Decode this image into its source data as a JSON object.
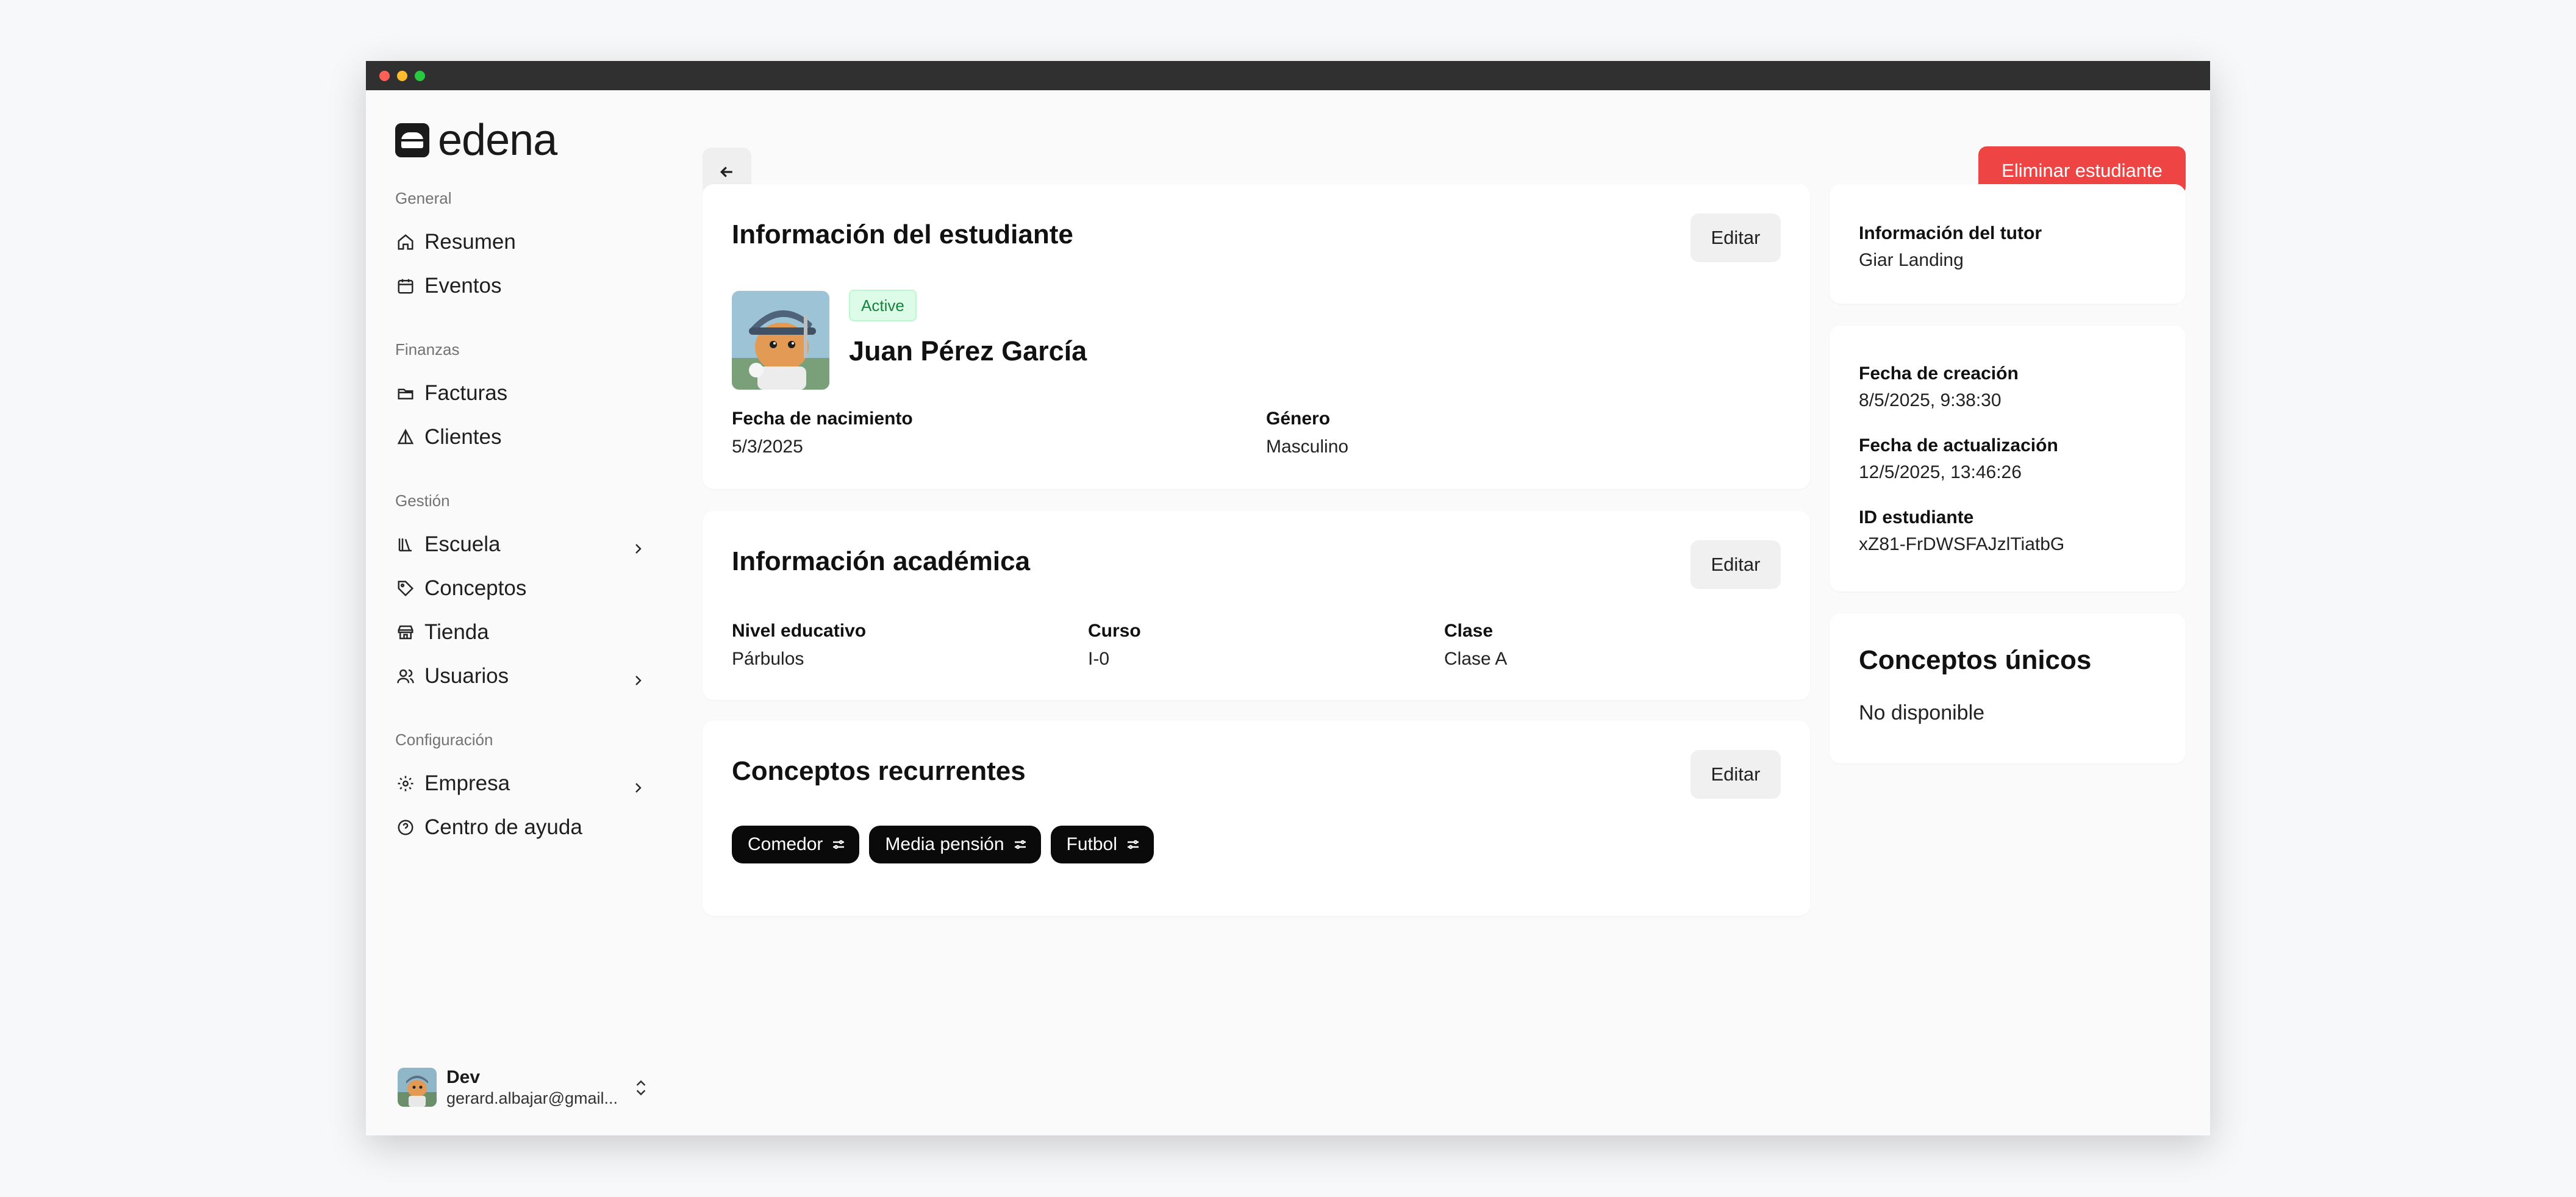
{
  "window": {
    "controls": [
      "#ff5f57",
      "#febc2e",
      "#28c840"
    ]
  },
  "brand": {
    "name": "edena"
  },
  "sidebar": {
    "sections": [
      {
        "heading": "General",
        "items": [
          {
            "label": "Resumen",
            "icon": "home-icon"
          },
          {
            "label": "Eventos",
            "icon": "calendar-icon"
          }
        ]
      },
      {
        "heading": "Finanzas",
        "items": [
          {
            "label": "Facturas",
            "icon": "folder-icon"
          },
          {
            "label": "Clientes",
            "icon": "clients-icon"
          }
        ]
      },
      {
        "heading": "Gestión",
        "items": [
          {
            "label": "Escuela",
            "icon": "library-icon",
            "chevron": true
          },
          {
            "label": "Conceptos",
            "icon": "tag-icon"
          },
          {
            "label": "Tienda",
            "icon": "store-icon"
          },
          {
            "label": "Usuarios",
            "icon": "users-icon",
            "chevron": true
          }
        ]
      },
      {
        "heading": "Configuración",
        "items": [
          {
            "label": "Empresa",
            "icon": "gear-icon",
            "chevron": true
          },
          {
            "label": "Centro de ayuda",
            "icon": "help-icon"
          }
        ]
      }
    ],
    "user": {
      "name": "Dev",
      "email": "gerard.albajar@gmail..."
    }
  },
  "header": {
    "delete_label": "Eliminar estudiante"
  },
  "student_card": {
    "title": "Información del estudiante",
    "edit_label": "Editar",
    "status": "Active",
    "name": "Juan Pérez García",
    "birth_label": "Fecha de nacimiento",
    "birth_value": "5/3/2025",
    "gender_label": "Género",
    "gender_value": "Masculino"
  },
  "academic_card": {
    "title": "Información académica",
    "edit_label": "Editar",
    "level_label": "Nivel educativo",
    "level_value": "Párbulos",
    "course_label": "Curso",
    "course_value": "I-0",
    "class_label": "Clase",
    "class_value": "Clase A"
  },
  "recurring_card": {
    "title": "Conceptos recurrentes",
    "edit_label": "Editar",
    "chips": [
      "Comedor",
      "Media pensión",
      "Futbol"
    ]
  },
  "tutor_card": {
    "label": "Información del tutor",
    "value": "Giar Landing"
  },
  "meta_card": {
    "created_label": "Fecha de creación",
    "created_value": "8/5/2025, 9:38:30",
    "updated_label": "Fecha de actualización",
    "updated_value": "12/5/2025, 13:46:26",
    "id_label": "ID estudiante",
    "id_value": "xZ81-FrDWSFAJzlTiatbG"
  },
  "unique_card": {
    "title": "Conceptos únicos",
    "value": "No disponible"
  },
  "colors": {
    "accent_danger": "#ef4444",
    "badge_green": "#15803d"
  }
}
